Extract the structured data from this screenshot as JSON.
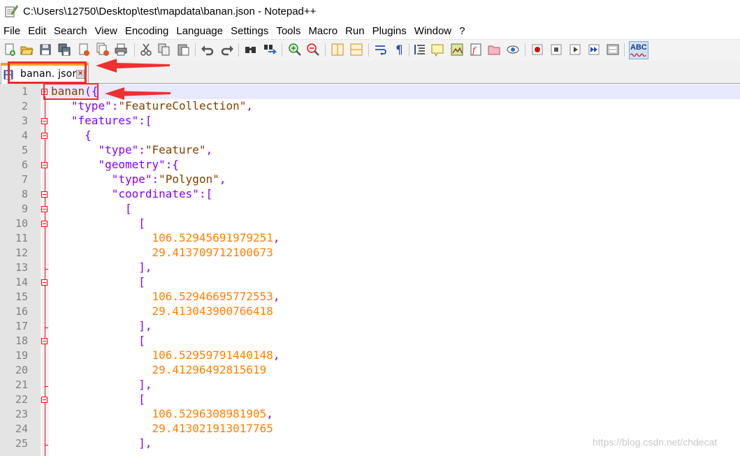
{
  "window": {
    "title": "C:\\Users\\12750\\Desktop\\test\\mapdata\\banan.json - Notepad++"
  },
  "menu": [
    "File",
    "Edit",
    "Search",
    "View",
    "Encoding",
    "Language",
    "Settings",
    "Tools",
    "Macro",
    "Run",
    "Plugins",
    "Window",
    "?"
  ],
  "toolbar": {
    "buttons": [
      "new-file-icon",
      "open-file-icon",
      "save-icon",
      "save-all-icon",
      "close-icon",
      "close-all-icon",
      "print-icon",
      "cut-icon",
      "copy-icon",
      "paste-icon",
      "undo-icon",
      "redo-icon",
      "find-icon",
      "replace-icon",
      "zoom-in-icon",
      "zoom-out-icon",
      "sync-vertical-icon",
      "sync-horizontal-icon",
      "word-wrap-icon",
      "show-all-characters-icon",
      "indent-guide-icon",
      "language-icon",
      "document-map-icon",
      "function-list-icon",
      "folder-as-workspace-icon",
      "monitoring-icon",
      "record-macro-icon",
      "stop-recording-icon",
      "play-macro-icon",
      "run-macro-multiple-icon",
      "save-macro-icon",
      "spell-check-icon"
    ],
    "spell_check_label": "ABC"
  },
  "tabs": [
    {
      "label": "banan. json",
      "active": true
    }
  ],
  "editor": {
    "lines": [
      {
        "num": "1"
      },
      {
        "num": "2"
      },
      {
        "num": "3"
      },
      {
        "num": "4"
      },
      {
        "num": "5"
      },
      {
        "num": "6"
      },
      {
        "num": "7"
      },
      {
        "num": "8"
      },
      {
        "num": "9"
      },
      {
        "num": "10"
      },
      {
        "num": "11"
      },
      {
        "num": "12"
      },
      {
        "num": "13"
      },
      {
        "num": "14"
      },
      {
        "num": "15"
      },
      {
        "num": "16"
      },
      {
        "num": "17"
      },
      {
        "num": "18"
      },
      {
        "num": "19"
      },
      {
        "num": "20"
      },
      {
        "num": "21"
      },
      {
        "num": "22"
      },
      {
        "num": "23"
      },
      {
        "num": "24"
      },
      {
        "num": "25"
      }
    ],
    "text": {
      "l1_ident": "banan",
      "l1_open": "({",
      "type_key": "\"type\"",
      "colon": ":",
      "comma": ",",
      "feature_collection": "\"FeatureCollection\"",
      "features_key": "\"features\"",
      "open_bracket": "[",
      "close_bracket_comma": "],",
      "open_brace": "{",
      "feature": "\"Feature\"",
      "geometry_key": "\"geometry\"",
      "polygon": "\"Polygon\"",
      "coordinates_key": "\"coordinates\"",
      "colon_brace": ":{",
      "colon_bracket": ":["
    },
    "coords": [
      {
        "lon": "106.52945691979251",
        "lat": "29.413709712100673"
      },
      {
        "lon": "106.52946695772553",
        "lat": "29.413043900766418"
      },
      {
        "lon": "106.52959791440148",
        "lat": "29.41296492815619"
      },
      {
        "lon": "106.5296308981905",
        "lat": "29.413021913017765"
      }
    ]
  },
  "watermark": "https://blog.csdn.net/chdecat",
  "colors": {
    "keyword": "#8000ff",
    "string": "#804000",
    "number": "#ff8000",
    "highlight_box": "#ee2c2c",
    "tab_accent": "#fa9a2e"
  }
}
